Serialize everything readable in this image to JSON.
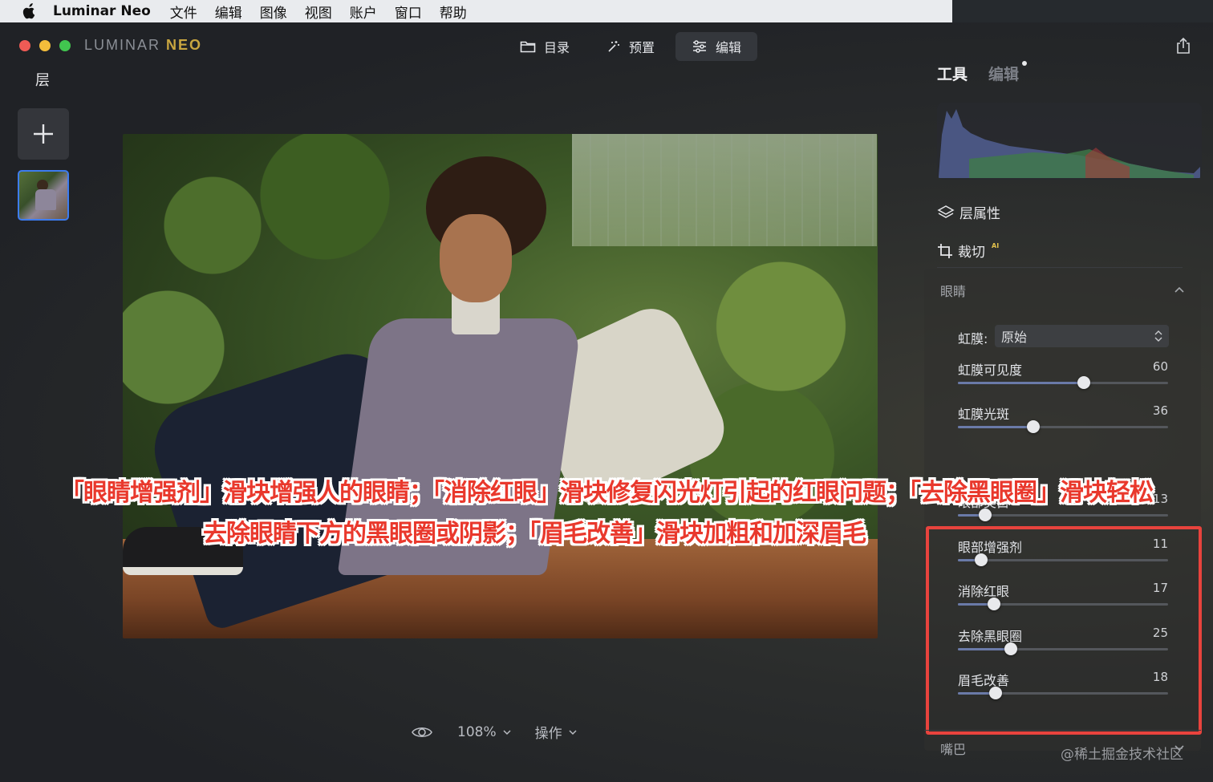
{
  "menubar": {
    "app_name": "Luminar Neo",
    "items": [
      "文件",
      "编辑",
      "图像",
      "视图",
      "账户",
      "窗口",
      "帮助"
    ]
  },
  "window": {
    "brand_main": "LUMINAR",
    "brand_neo": "NEO",
    "nav": [
      {
        "label": "目录",
        "icon": "folder-icon"
      },
      {
        "label": "预置",
        "icon": "magic-wand-icon"
      },
      {
        "label": "编辑",
        "icon": "sliders-icon"
      }
    ],
    "active_nav": "编辑"
  },
  "layers": {
    "title": "层"
  },
  "bottombar": {
    "zoom": "108%",
    "actions": "操作"
  },
  "rightpanel": {
    "tab_tools": "工具",
    "tab_edit": "编辑",
    "layer_props": "层属性",
    "crop": "裁切",
    "crop_badge": "AI",
    "eyes_section": "眼睛",
    "iris_label": "虹膜:",
    "iris_value": "原始",
    "sliders": [
      {
        "label": "虹膜可见度",
        "value": 60,
        "display": "60"
      },
      {
        "label": "虹膜光斑",
        "value": 36,
        "display": "36"
      },
      {
        "label": "眼部美白",
        "value": 13,
        "display": "13"
      },
      {
        "label": "眼部增强剂",
        "value": 11,
        "display": "11"
      },
      {
        "label": "消除红眼",
        "value": 17,
        "display": "17"
      },
      {
        "label": "去除黑眼圈",
        "value": 25,
        "display": "25"
      },
      {
        "label": "眉毛改善",
        "value": 18,
        "display": "18"
      }
    ],
    "mouth_section": "嘴巴"
  },
  "caption": {
    "line1": "「眼睛增强剂」滑块增强人的眼睛；「消除红眼」滑块修复闪光灯引起的红眼问题；「去除黑眼圈」滑块轻松",
    "line2": "去除眼睛下方的黑眼圈或阴影；「眉毛改善」滑块加粗和加深眉毛"
  },
  "watermark": "@稀土掘金技术社区",
  "colors": {
    "accent_blue": "#3d7cf0",
    "highlight_red": "#e8433d",
    "caption_red": "#e9382c",
    "neo_gold": "#c9a640"
  }
}
